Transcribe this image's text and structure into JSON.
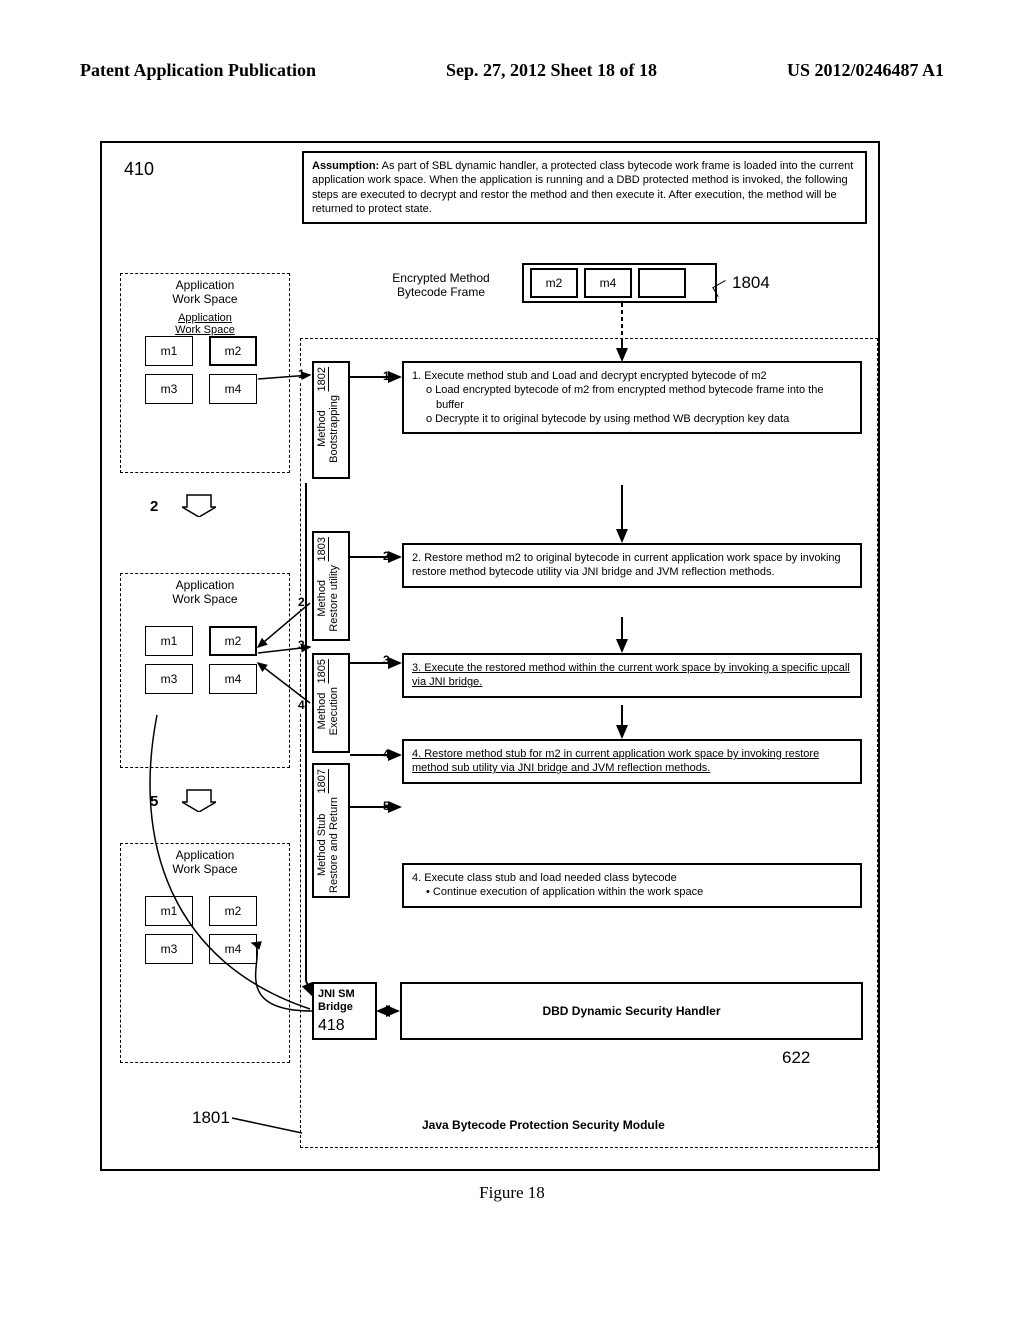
{
  "header": {
    "left": "Patent Application Publication",
    "mid": "Sep. 27, 2012  Sheet 18 of 18",
    "right": "US 2012/0246487 A1"
  },
  "ref410": "410",
  "assumption": {
    "label": "Assumption:",
    "text": " As part of SBL dynamic handler, a protected class bytecode work frame is loaded into the current application work space. When the application is running and a DBD protected method is invoked, the following steps are executed to decrypt and restor the method and then execute it. After execution, the method will be returned to protect state."
  },
  "workspace": {
    "title": "Application\nWork Space",
    "sub": "Application\nWork Space",
    "cells": {
      "m1": "m1",
      "m2": "m2",
      "m3": "m3",
      "m4": "m4"
    }
  },
  "enc": {
    "title": "Encrypted Method\nBytecode Frame",
    "m2": "m2",
    "m4": "m4",
    "ref1804": "1804"
  },
  "vproc": {
    "p1": {
      "name": "Method\nBootstrapping",
      "ref": "1802"
    },
    "p2": {
      "name": "Method\nRestore utility",
      "ref": "1803"
    },
    "p3": {
      "name": "Method\nExecution",
      "ref": "1805"
    },
    "p4": {
      "name": "Method Stub\nRestore and Return",
      "ref": "1807"
    }
  },
  "steps": {
    "s1": {
      "head": "1. Execute method stub and Load and decrypt encrypted bytecode of m2",
      "b1": "o   Load encrypted bytecode of m2 from encrypted method bytecode frame into the buffer",
      "b2": "o   Decrypte it to original bytecode by using method WB decryption key data"
    },
    "s2": "2. Restore method m2 to original bytecode in current application work space by invoking restore method bytecode utility via JNI bridge and JVM reflection methods.",
    "s3": "3. Execute the restored method within the current work space by invoking a specific upcall via JNI bridge.",
    "s4": "4. Restore method stub for m2 in current application work space by invoking restore method sub utility via JNI bridge and JVM reflection methods.",
    "s5": {
      "head": "4. Execute class stub and load needed class bytecode",
      "b1": "•   Continue execution of application within the work space"
    }
  },
  "dbd": "DBD Dynamic Security Handler",
  "dbd622": "622",
  "jni": {
    "l1": "JNI SM",
    "l2": "Bridge",
    "ref": "418"
  },
  "secmod": "Java Bytecode Protection Security Module",
  "ref1801": "1801",
  "trans": {
    "t2": "2",
    "t5": "5"
  },
  "numtags": {
    "n1": "1",
    "n2": "2",
    "n3": "3",
    "n4": "4",
    "n5": "5"
  },
  "figcap": "Figure 18"
}
